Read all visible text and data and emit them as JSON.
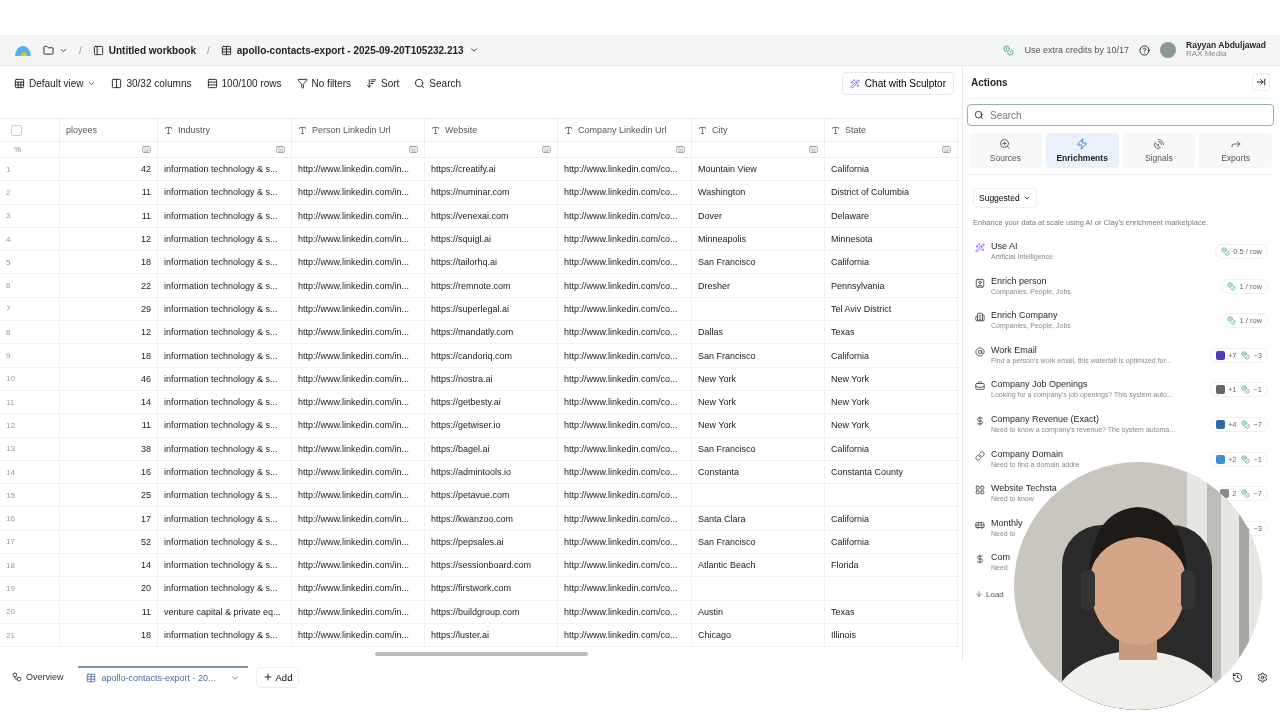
{
  "topbar": {
    "separators": [
      "/",
      "/"
    ],
    "workbook": "Untitled workbook",
    "table": "apollo-contacts-export - 2025-09-20T105232.213",
    "credits": "Use extra credits by 10/17",
    "user": {
      "name": "Rayyan Abduljawad",
      "org": "RAX Media"
    }
  },
  "toolbar": {
    "items": [
      {
        "label": "Default view",
        "kind": "view"
      },
      {
        "label": "30/32 columns",
        "kind": "columns"
      },
      {
        "label": "100/100 rows",
        "kind": "rows"
      },
      {
        "label": "No filters",
        "kind": "filter"
      },
      {
        "label": "Sort",
        "kind": "sort"
      },
      {
        "label": "Search",
        "kind": "search"
      }
    ],
    "chat": "Chat with Sculptor"
  },
  "table": {
    "select_all": {
      "checked": false
    },
    "filter_label": "%",
    "columns": [
      {
        "label": "ployees",
        "kind": "cut"
      },
      {
        "label": "Industry",
        "kind": "text"
      },
      {
        "label": "Person Linkedin Url",
        "kind": "text"
      },
      {
        "label": "Website",
        "kind": "text"
      },
      {
        "label": "Company Linkedin Url",
        "kind": "text"
      },
      {
        "label": "City",
        "kind": "text"
      },
      {
        "label": "State",
        "kind": "text"
      }
    ],
    "rows": [
      {
        "n": "1",
        "employees": "42",
        "industry": "information technology & s...",
        "person_linkedin": "http://www.linkedin.com/in...",
        "website": "https://creatify.ai",
        "company_linkedin": "http://www.linkedin.com/co...",
        "city": "Mountain View",
        "state": "California"
      },
      {
        "n": "2",
        "employees": "11",
        "industry": "information technology & s...",
        "person_linkedin": "http://www.linkedin.com/in...",
        "website": "https://numinar.com",
        "company_linkedin": "http://www.linkedin.com/co...",
        "city": "Washington",
        "state": "District of Columbia"
      },
      {
        "n": "3",
        "employees": "11",
        "industry": "information technology & s...",
        "person_linkedin": "http://www.linkedin.com/in...",
        "website": "https://venexai.com",
        "company_linkedin": "http://www.linkedin.com/co...",
        "city": "Dover",
        "state": "Delaware"
      },
      {
        "n": "4",
        "employees": "12",
        "industry": "information technology & s...",
        "person_linkedin": "http://www.linkedin.com/in...",
        "website": "https://squigl.ai",
        "company_linkedin": "http://www.linkedin.com/co...",
        "city": "Minneapolis",
        "state": "Minnesota"
      },
      {
        "n": "5",
        "employees": "18",
        "industry": "information technology & s...",
        "person_linkedin": "http://www.linkedin.com/in...",
        "website": "https://tailorhq.ai",
        "company_linkedin": "http://www.linkedin.com/co...",
        "city": "San Francisco",
        "state": "California"
      },
      {
        "n": "6",
        "employees": "22",
        "industry": "information technology & s...",
        "person_linkedin": "http://www.linkedin.com/in...",
        "website": "https://remnote.com",
        "company_linkedin": "http://www.linkedin.com/co...",
        "city": "Dresher",
        "state": "Pennsylvania"
      },
      {
        "n": "7",
        "employees": "29",
        "industry": "information technology & s...",
        "person_linkedin": "http://www.linkedin.com/in...",
        "website": "https://superlegal.ai",
        "company_linkedin": "http://www.linkedin.com/co...",
        "state": "Tel Aviv District"
      },
      {
        "n": "8",
        "employees": "12",
        "industry": "information technology & s...",
        "person_linkedin": "http://www.linkedin.com/in...",
        "website": "https://mandatly.com",
        "company_linkedin": "http://www.linkedin.com/co...",
        "city": "Dallas",
        "state": "Texas"
      },
      {
        "n": "9",
        "employees": "18",
        "industry": "information technology & s...",
        "person_linkedin": "http://www.linkedin.com/in...",
        "website": "https://candoriq.com",
        "company_linkedin": "http://www.linkedin.com/co...",
        "city": "San Francisco",
        "state": "California"
      },
      {
        "n": "10",
        "employees": "46",
        "industry": "information technology & s...",
        "person_linkedin": "http://www.linkedin.com/in...",
        "website": "https://nostra.ai",
        "company_linkedin": "http://www.linkedin.com/co...",
        "city": "New York",
        "state": "New York"
      },
      {
        "n": "11",
        "employees": "14",
        "industry": "information technology & s...",
        "person_linkedin": "http://www.linkedin.com/in...",
        "website": "https://getbesty.ai",
        "company_linkedin": "http://www.linkedin.com/co...",
        "city": "New York",
        "state": "New York"
      },
      {
        "n": "12",
        "employees": "11",
        "industry": "information technology & s...",
        "person_linkedin": "http://www.linkedin.com/in...",
        "website": "https://getwiser.io",
        "company_linkedin": "http://www.linkedin.com/co...",
        "city": "New York",
        "state": "New York"
      },
      {
        "n": "13",
        "employees": "38",
        "industry": "information technology & s...",
        "person_linkedin": "http://www.linkedin.com/in...",
        "website": "https://bagel.ai",
        "company_linkedin": "http://www.linkedin.com/co...",
        "city": "San Francisco",
        "state": "California"
      },
      {
        "n": "14",
        "employees": "16",
        "industry": "information technology & s...",
        "person_linkedin": "http://www.linkedin.com/in...",
        "website": "https://admintools.io",
        "company_linkedin": "http://www.linkedin.com/co...",
        "city": "Constanta",
        "state": "Constanta County"
      },
      {
        "n": "15",
        "employees": "25",
        "industry": "information technology & s...",
        "person_linkedin": "http://www.linkedin.com/in...",
        "website": "https://petavue.com",
        "company_linkedin": "http://www.linkedin.com/co..."
      },
      {
        "n": "16",
        "employees": "17",
        "industry": "information technology & s...",
        "person_linkedin": "http://www.linkedin.com/in...",
        "website": "https://kwanzoo.com",
        "company_linkedin": "http://www.linkedin.com/co...",
        "city": "Santa Clara",
        "state": "California"
      },
      {
        "n": "17",
        "employees": "52",
        "industry": "information technology & s...",
        "person_linkedin": "http://www.linkedin.com/in...",
        "website": "https://pepsales.ai",
        "company_linkedin": "http://www.linkedin.com/co...",
        "city": "San Francisco",
        "state": "California"
      },
      {
        "n": "18",
        "employees": "14",
        "industry": "information technology & s...",
        "person_linkedin": "http://www.linkedin.com/in...",
        "website": "https://sessionboard.com",
        "company_linkedin": "http://www.linkedin.com/co...",
        "city": "Atlantic Beach",
        "state": "Florida"
      },
      {
        "n": "19",
        "employees": "20",
        "industry": "information technology & s...",
        "person_linkedin": "http://www.linkedin.com/in...",
        "website": "https://firstwork.com",
        "company_linkedin": "http://www.linkedin.com/co..."
      },
      {
        "n": "20",
        "employees": "11",
        "industry": "venture capital & private eq...",
        "person_linkedin": "http://www.linkedin.com/in...",
        "website": "https://buildgroup.com",
        "company_linkedin": "http://www.linkedin.com/co...",
        "city": "Austin",
        "state": "Texas"
      },
      {
        "n": "21",
        "employees": "18",
        "industry": "information technology & s...",
        "person_linkedin": "http://www.linkedin.com/in...",
        "website": "https://luster.ai",
        "company_linkedin": "http://www.linkedin.com/co...",
        "city": "Chicago",
        "state": "Illinois"
      }
    ]
  },
  "actions": {
    "title": "Actions",
    "search": {
      "placeholder": "Search"
    },
    "tabs": [
      {
        "label": "Sources",
        "kind": "sources",
        "selected": false
      },
      {
        "label": "Enrichments",
        "kind": "enrichments",
        "selected": true
      },
      {
        "label": "Signals",
        "kind": "signals",
        "selected": false
      },
      {
        "label": "Exports",
        "kind": "exports",
        "selected": false
      }
    ],
    "filter": "Suggested",
    "description": "Enhance your data at scale using AI or Clay's enrichment marketplace.",
    "items": [
      {
        "title": "Use AI",
        "subtitle": "Artificial Intelligence",
        "badges": [
          {
            "kind": "credits",
            "text": "0.5 / row"
          }
        ]
      },
      {
        "title": "Enrich person",
        "subtitle": "Companies, People, Jobs",
        "badges": [
          {
            "kind": "credits",
            "text": "1 / row"
          }
        ]
      },
      {
        "title": "Enrich Company",
        "subtitle": "Companies, People, Jobs",
        "badges": [
          {
            "kind": "credits",
            "text": "1 / row"
          }
        ]
      },
      {
        "title": "Work Email",
        "subtitle": "Find a person's work email, this waterfall is optimized for...",
        "badges": [
          {
            "kind": "tool",
            "text": "+7",
            "color": "#4b3bc4"
          },
          {
            "kind": "credits",
            "text": "~3"
          }
        ]
      },
      {
        "title": "Company Job Openings",
        "subtitle": "Looking for a company's job openings? This system auto...",
        "badges": [
          {
            "kind": "tool",
            "text": "+1",
            "color": "#666666"
          },
          {
            "kind": "credits",
            "text": "~1"
          }
        ]
      },
      {
        "title": "Company Revenue (Exact)",
        "subtitle": "Need to know a company's revenue? The system automa...",
        "badges": [
          {
            "kind": "tool",
            "text": "+4",
            "color": "#2c6aa8"
          },
          {
            "kind": "credits",
            "text": "~7"
          }
        ]
      },
      {
        "title": "Company Domain",
        "subtitle": "Need to find a domain addre",
        "badges": [
          {
            "kind": "tool",
            "text": "+2",
            "color": "#3d8fd8"
          },
          {
            "kind": "credits",
            "text": "~1"
          }
        ]
      },
      {
        "title": "Website Techsta",
        "subtitle": "Need to know",
        "badges": [
          {
            "kind": "tool",
            "text": "2",
            "color": "#888888"
          },
          {
            "kind": "credits",
            "text": "~7"
          }
        ]
      },
      {
        "title": "Monthly",
        "subtitle": "Need to",
        "badges": [
          {
            "kind": "credits",
            "text": "~3"
          }
        ]
      },
      {
        "title": "Com",
        "subtitle": "Need"
      }
    ],
    "load": "Load"
  },
  "bottombar": {
    "overview": "Overview",
    "tabs": [
      {
        "label": "apollo-contacts-export - 20...",
        "selected": true
      }
    ],
    "add": "Add"
  }
}
